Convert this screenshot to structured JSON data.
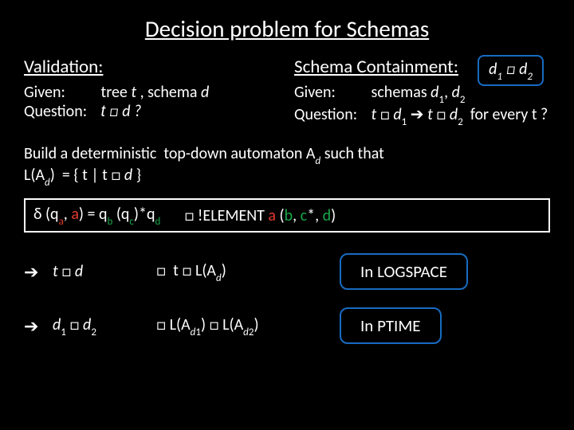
{
  "title": "Decision problem for Schemas",
  "left": {
    "heading": "Validation:",
    "given_label": "Given:",
    "given_value_pre": "tree ",
    "given_t": "t",
    "given_mid": " , schema ",
    "given_d": "d",
    "q_label": "Question:",
    "q_value": "t □ d ?"
  },
  "right": {
    "heading": "Schema Containment:",
    "given_label": "Given:",
    "given_value": "schemas d₁, d₂",
    "q_label": "Question:",
    "q_value": "t □ d₁ ➔ t □ d₂  for every t ?"
  },
  "badge": "d₁ □ d₂",
  "automaton_line1": "Build a deterministic  top-down automaton Ad such that",
  "automaton_line2": "L(Ad)  = { t | t □ d }",
  "delta": {
    "d": "δ (q",
    "a1": "a",
    "mid1": ", ",
    "a2": "a",
    "mid2": ") = q",
    "b": "b",
    "mid3": " (q",
    "c": "c",
    "mid4": ")*q",
    "dd": "d"
  },
  "element_decl": "□ !ELEMENT a (b, c*, d)",
  "rows": {
    "r1_arrow": "➔",
    "r1_expr": "t □ d",
    "r1_iff": "□  t □ L(Ad)",
    "r1_bubble": "In LOGSPACE",
    "r2_arrow": "➔",
    "r2_expr": "d₁ □ d₂",
    "r2_iff": "□ L(Ad₁) □ L(Ad₂)",
    "r2_bubble": "In PTIME"
  }
}
